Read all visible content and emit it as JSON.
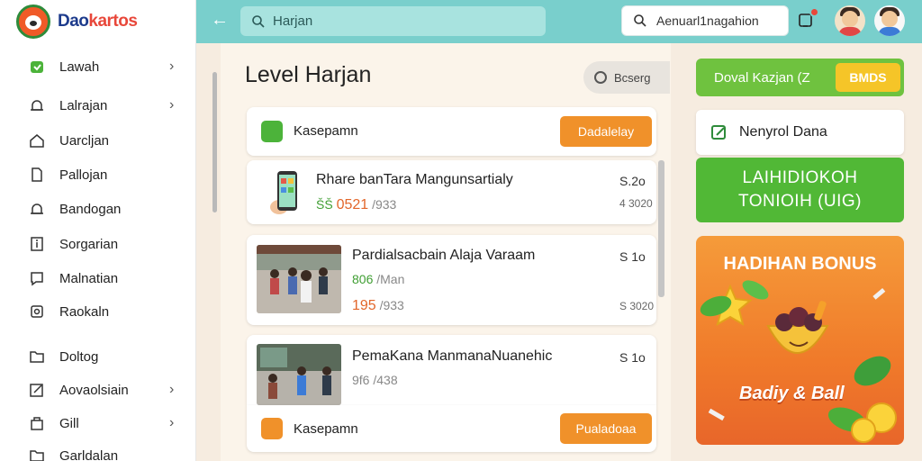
{
  "app": {
    "logo_prefix": "Dao",
    "logo_suffix": "kartos"
  },
  "sidebar": {
    "items": [
      {
        "label": "Lawah",
        "icon": "tag-icon",
        "has_chevron": true
      },
      {
        "label": "Lalrajan",
        "icon": "bell-icon",
        "has_chevron": true
      },
      {
        "label": "Uarcljan",
        "icon": "home-icon",
        "has_chevron": false
      },
      {
        "label": "Pallojan",
        "icon": "file-icon",
        "has_chevron": false
      },
      {
        "label": "Bandogan",
        "icon": "bell-icon",
        "has_chevron": false
      },
      {
        "label": "Sorgarian",
        "icon": "info-icon",
        "has_chevron": false
      },
      {
        "label": "Malnatian",
        "icon": "chat-icon",
        "has_chevron": false
      },
      {
        "label": "Raokaln",
        "icon": "settings-icon",
        "has_chevron": false
      },
      {
        "label": "Doltog",
        "icon": "folder-icon",
        "has_chevron": false
      },
      {
        "label": "Aovaolsiain",
        "icon": "edit-icon",
        "has_chevron": true
      },
      {
        "label": "Gill",
        "icon": "bag-icon",
        "has_chevron": true
      },
      {
        "label": "Garldalan",
        "icon": "folder-icon",
        "has_chevron": false
      }
    ]
  },
  "header": {
    "search_value": "Harjan",
    "search_right_value": "Aenuarl1nagahion"
  },
  "main": {
    "title": "Level Harjan",
    "segment_label": "Bcserg",
    "top_bar": {
      "label": "Kasepamn",
      "button_label": "Dadalelay"
    },
    "items": [
      {
        "title": "Rhare banTara Mangunsartialy",
        "price_a": "ŠŠ",
        "price_b": "0521",
        "price_c": "/933",
        "right_top": "S.2o",
        "right_bottom": "4 3020"
      },
      {
        "title": "Pardialsacbain Alaja Varaam",
        "price_a": "806",
        "price_b": "/Man",
        "price_c": "",
        "second_line": "195",
        "second_line_b": "/933",
        "right_top": "S 1o",
        "right_bottom": "S 3020"
      },
      {
        "title": "PemaKana ManmanaNuanehic",
        "price_a": "9f6",
        "price_b": "/438",
        "price_c": "",
        "right_top": "S 1o",
        "right_bottom": ""
      }
    ],
    "bottom_bar": {
      "label": "Kasepamn",
      "button_label": "Pualadoaa"
    }
  },
  "right_panel": {
    "promo_label": "Doval Kazjan (Z",
    "promo_badge": "BMDS",
    "pill_label": "Nenyrol Dana",
    "green_line1": "LAIHIDIOKOH",
    "green_line2": "TONIOIH (UIG)",
    "bonus_title": "HADIHAN BONUS",
    "bonus_sub": "Badiy & Ball"
  },
  "colors": {
    "header": "#79cfcc",
    "accent_orange": "#f0912a",
    "accent_green": "#51b836",
    "price_orange": "#e2662a",
    "price_green": "#3f9e32"
  }
}
